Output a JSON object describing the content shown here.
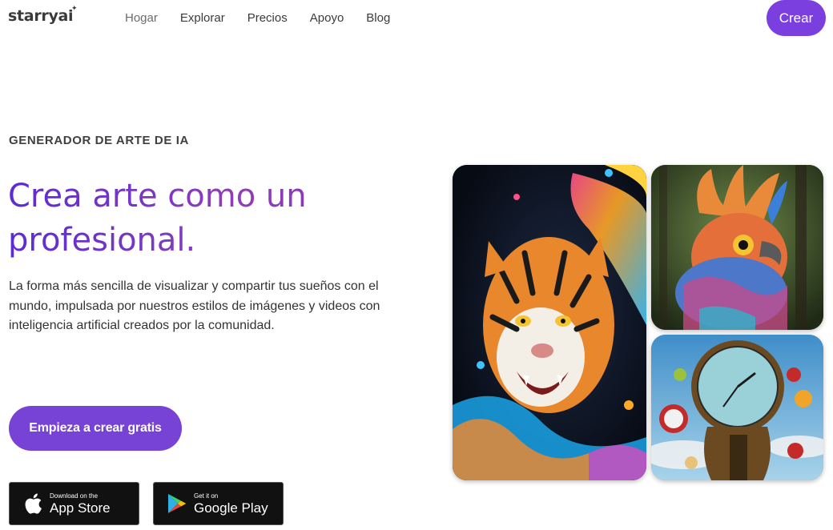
{
  "nav": {
    "logo": "starryai",
    "links": [
      "Hogar",
      "Explorar",
      "Precios",
      "Apoyo",
      "Blog"
    ],
    "cta": "Crear"
  },
  "hero": {
    "eyebrow": "GENERADOR DE ARTE DE IA",
    "headline_line1": "Crea arte como un",
    "headline_line2": "profesional.",
    "description": "La forma más sencilla de visualizar y compartir tus sueños con el mundo, impulsada por nuestros estilos de imágenes y videos con inteligencia artificial creados por la comunidad.",
    "cta": "Empieza a crear gratis"
  },
  "stores": {
    "apple": {
      "small": "Download on the",
      "big": "App Store",
      "icon": "apple-icon"
    },
    "google": {
      "small": "Get it on",
      "big": "Google Play",
      "icon": "google-play-icon"
    }
  },
  "gallery": [
    "tiger",
    "bird",
    "clock"
  ],
  "colors": {
    "accent": "#7b3fe0",
    "headline_start": "#5b2bd6",
    "headline_end": "#8e3fb7"
  }
}
